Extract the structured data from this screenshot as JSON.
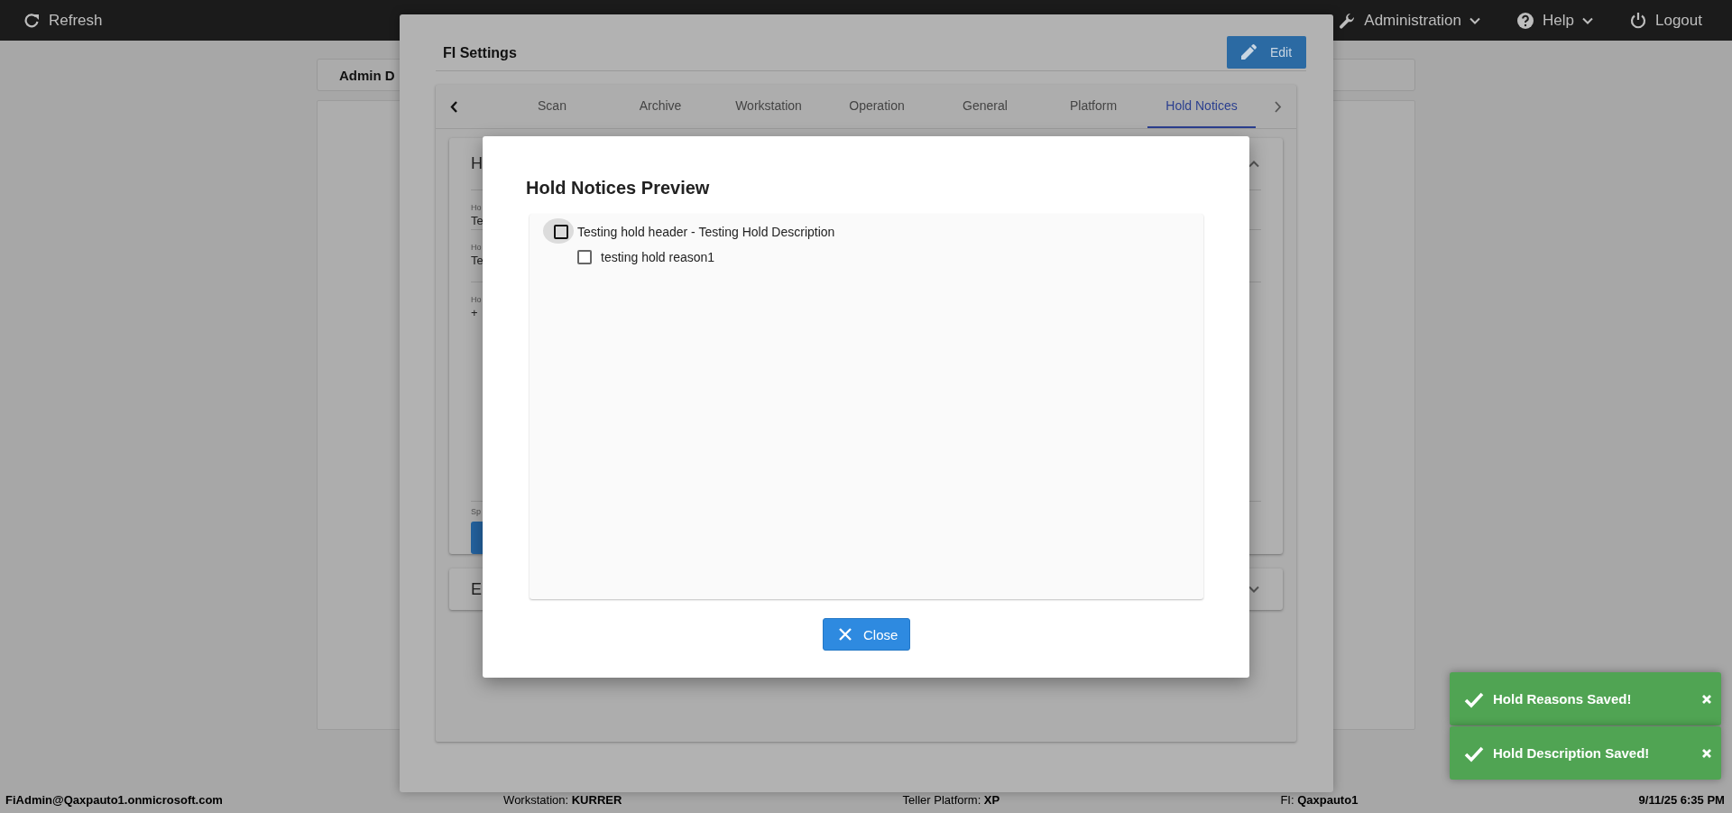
{
  "top_bar": {
    "refresh": "Refresh",
    "menus": [
      {
        "label": "Administration",
        "kind": "dropdown"
      },
      {
        "label": "Help",
        "kind": "dropdown"
      },
      {
        "label": "Logout",
        "kind": "plain"
      }
    ]
  },
  "page": {
    "card_title": "Admin D"
  },
  "fi_settings": {
    "title": "FI Settings",
    "edit_button": "Edit",
    "tabs": [
      {
        "label": "Scan",
        "selected": false
      },
      {
        "label": "Archive",
        "selected": false
      },
      {
        "label": "Workstation",
        "selected": false
      },
      {
        "label": "Operation",
        "selected": false
      },
      {
        "label": "General",
        "selected": false
      },
      {
        "label": "Platform",
        "selected": false
      },
      {
        "label": "Hold Notices",
        "selected": true
      }
    ],
    "panels": [
      {
        "heading": "H",
        "expanded": true,
        "fields": [
          {
            "label": "Ho",
            "value": "Te"
          },
          {
            "label": "Ho",
            "value": "Te"
          },
          {
            "label": "Ho",
            "value": "+"
          }
        ],
        "footer_label": "Sp"
      },
      {
        "heading": "E",
        "expanded": false
      }
    ]
  },
  "dialog": {
    "title": "Hold Notices Preview",
    "tree": [
      {
        "label": "Testing hold header - Testing Hold Description",
        "checked": false,
        "focused": true,
        "children": [
          {
            "label": "testing hold reason1",
            "checked": false,
            "focused": false
          }
        ]
      }
    ],
    "close_button": "Close"
  },
  "toasts": [
    {
      "message": "Hold Reasons Saved!"
    },
    {
      "message": "Hold Description Saved!"
    }
  ],
  "status_bar": [
    {
      "value": "FiAdmin@Qaxpauto1.onmicrosoft.com"
    },
    {
      "label": "Workstation:",
      "value": "KURRER"
    },
    {
      "label": "Teller Platform:",
      "value": "XP"
    },
    {
      "label": "FI:",
      "value": "Qaxpauto1"
    },
    {
      "value": "9/11/25 6:35 PM"
    }
  ]
}
